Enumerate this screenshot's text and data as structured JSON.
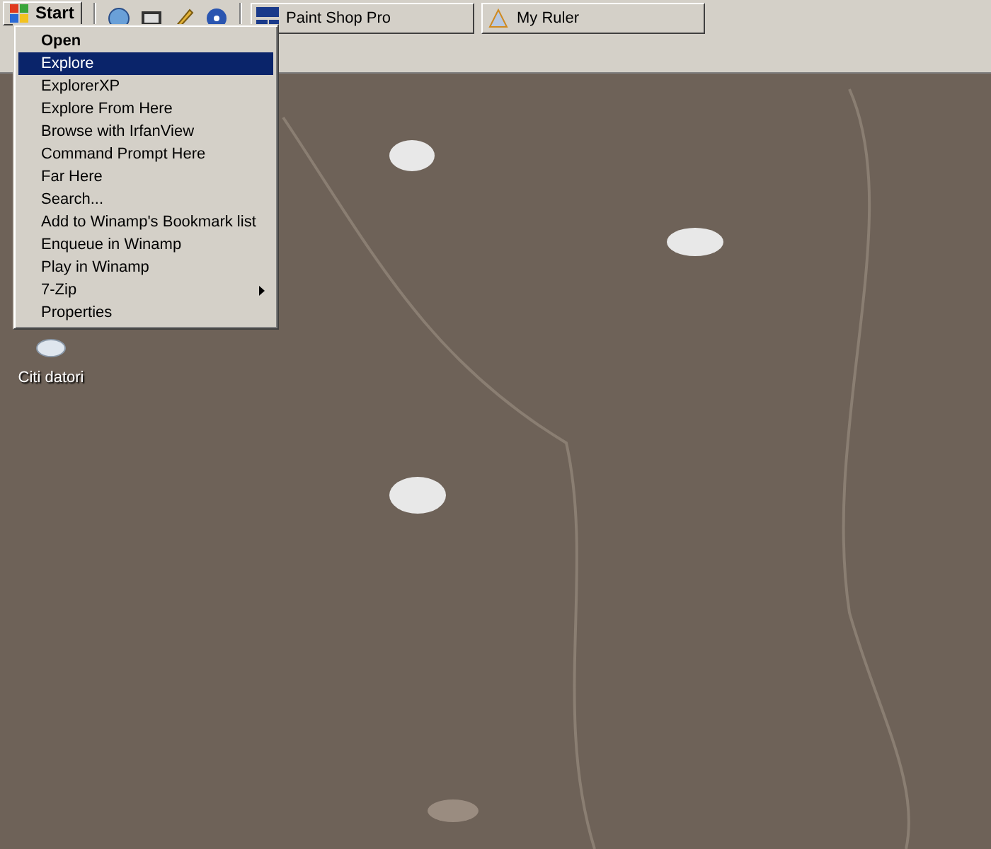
{
  "taskbar": {
    "start_button": "Start",
    "tasks": [
      {
        "label": "Paint Shop Pro",
        "kind": "paint"
      },
      {
        "label": "My Ruler",
        "kind": "ruler"
      }
    ]
  },
  "context_menu": {
    "items": [
      {
        "label": "Open",
        "default": true,
        "selected": false,
        "submenu": false
      },
      {
        "label": "Explore",
        "default": false,
        "selected": true,
        "submenu": false
      },
      {
        "label": "ExplorerXP",
        "default": false,
        "selected": false,
        "submenu": false
      },
      {
        "label": "Explore From Here",
        "default": false,
        "selected": false,
        "submenu": false
      },
      {
        "label": "Browse with IrfanView",
        "default": false,
        "selected": false,
        "submenu": false
      },
      {
        "label": "Command Prompt Here",
        "default": false,
        "selected": false,
        "submenu": false
      },
      {
        "label": "Far Here",
        "default": false,
        "selected": false,
        "submenu": false
      },
      {
        "label": "Search...",
        "default": false,
        "selected": false,
        "submenu": false
      },
      {
        "label": "Add to Winamp's Bookmark list",
        "default": false,
        "selected": false,
        "submenu": false
      },
      {
        "label": "Enqueue in Winamp",
        "default": false,
        "selected": false,
        "submenu": false
      },
      {
        "label": "Play in Winamp",
        "default": false,
        "selected": false,
        "submenu": false
      },
      {
        "label": "7-Zip",
        "default": false,
        "selected": false,
        "submenu": true
      },
      {
        "label": "Properties",
        "default": false,
        "selected": false,
        "submenu": false
      }
    ]
  },
  "desktop_icons": [
    {
      "label": "Citi datori"
    }
  ]
}
